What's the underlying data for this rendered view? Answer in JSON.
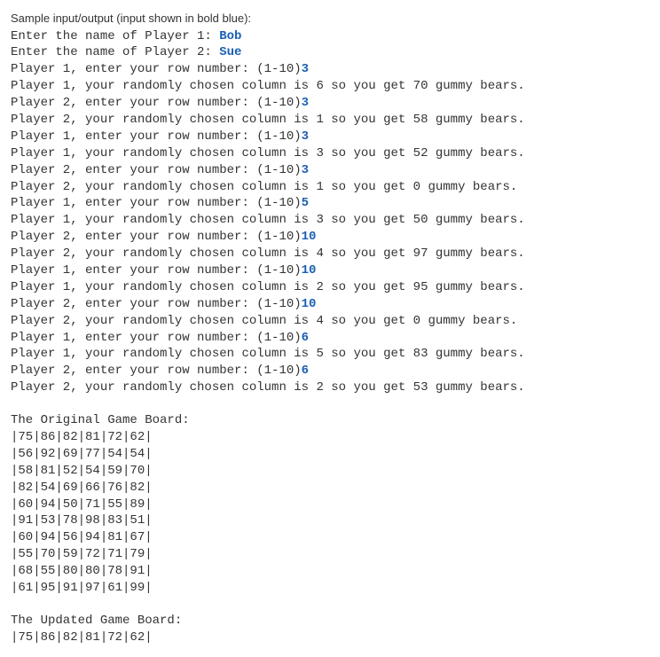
{
  "header": "Sample input/output (input shown in bold blue):",
  "prompt1_label": "Enter the name of Player 1: ",
  "prompt1_input": "Bob",
  "prompt2_label": "Enter the name of Player 2: ",
  "prompt2_input": "Sue",
  "rounds": [
    {
      "prompt": "Player 1, enter your row number: (1-10)",
      "input": "3",
      "result": "Player 1, your randomly chosen column is 6 so you get 70 gummy bears."
    },
    {
      "prompt": "Player 2, enter your row number: (1-10)",
      "input": "3",
      "result": "Player 2, your randomly chosen column is 1 so you get 58 gummy bears."
    },
    {
      "prompt": "Player 1, enter your row number: (1-10)",
      "input": "3",
      "result": "Player 1, your randomly chosen column is 3 so you get 52 gummy bears."
    },
    {
      "prompt": "Player 2, enter your row number: (1-10)",
      "input": "3",
      "result": "Player 2, your randomly chosen column is 1 so you get 0 gummy bears."
    },
    {
      "prompt": "Player 1, enter your row number: (1-10)",
      "input": "5",
      "result": "Player 1, your randomly chosen column is 3 so you get 50 gummy bears."
    },
    {
      "prompt": "Player 2, enter your row number: (1-10)",
      "input": "10",
      "result": "Player 2, your randomly chosen column is 4 so you get 97 gummy bears."
    },
    {
      "prompt": "Player 1, enter your row number: (1-10)",
      "input": "10",
      "result": "Player 1, your randomly chosen column is 2 so you get 95 gummy bears."
    },
    {
      "prompt": "Player 2, enter your row number: (1-10)",
      "input": "10",
      "result": "Player 2, your randomly chosen column is 4 so you get 0 gummy bears."
    },
    {
      "prompt": "Player 1, enter your row number: (1-10)",
      "input": "6",
      "result": "Player 1, your randomly chosen column is 5 so you get 83 gummy bears."
    },
    {
      "prompt": "Player 2, enter your row number: (1-10)",
      "input": "6",
      "result": "Player 2, your randomly chosen column is 2 so you get 53 gummy bears."
    }
  ],
  "board1_title": "The Original Game Board:",
  "board1_rows": [
    "|75|86|82|81|72|62|",
    "|56|92|69|77|54|54|",
    "|58|81|52|54|59|70|",
    "|82|54|69|66|76|82|",
    "|60|94|50|71|55|89|",
    "|91|53|78|98|83|51|",
    "|60|94|56|94|81|67|",
    "|55|70|59|72|71|79|",
    "|68|55|80|80|78|91|",
    "|61|95|91|97|61|99|"
  ],
  "board2_title": "The Updated Game Board:",
  "board2_rows": [
    "|75|86|82|81|72|62|"
  ]
}
